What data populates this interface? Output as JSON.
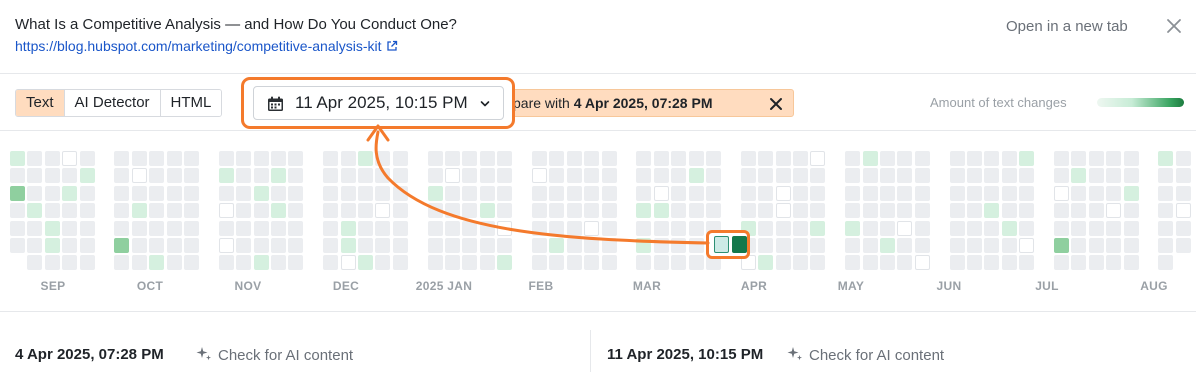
{
  "header": {
    "title": "What Is a Competitive Analysis — and How Do You Conduct One?",
    "url": "https://blog.hubspot.com/marketing/competitive-analysis-kit",
    "open_new_tab": "Open in a new tab",
    "close_icon": "close-icon"
  },
  "toolbar": {
    "view_tabs": [
      "Text",
      "AI Detector",
      "HTML"
    ],
    "active_tab": "Text",
    "selected_date": "11 Apr 2025, 10:15 PM",
    "compare_prefix": "pare with ",
    "compare_date": "4 Apr 2025, 07:28 PM",
    "legend_label": "Amount of text changes"
  },
  "timeline": {
    "months": [
      "SEP",
      "OCT",
      "NOV",
      "DEC",
      "2025 JAN",
      "FEB",
      "MAR",
      "APR",
      "MAY",
      "JUN",
      "JUL",
      "AUG"
    ],
    "selected_pair": [
      "4 Apr 2025, 07:28 PM",
      "11 Apr 2025, 10:15 PM"
    ]
  },
  "bottom": {
    "left_date": "4 Apr 2025, 07:28 PM",
    "right_date": "11 Apr 2025, 10:15 PM",
    "ai_check": "Check for AI content"
  },
  "colors": {
    "accent_orange": "#f47a2c",
    "pill_bg": "#ffdcbf",
    "empty_cell": "#ebedf0",
    "light_green": "#d5f0df",
    "medium_green": "#8fcf9f",
    "dark_green": "#14784b"
  }
}
